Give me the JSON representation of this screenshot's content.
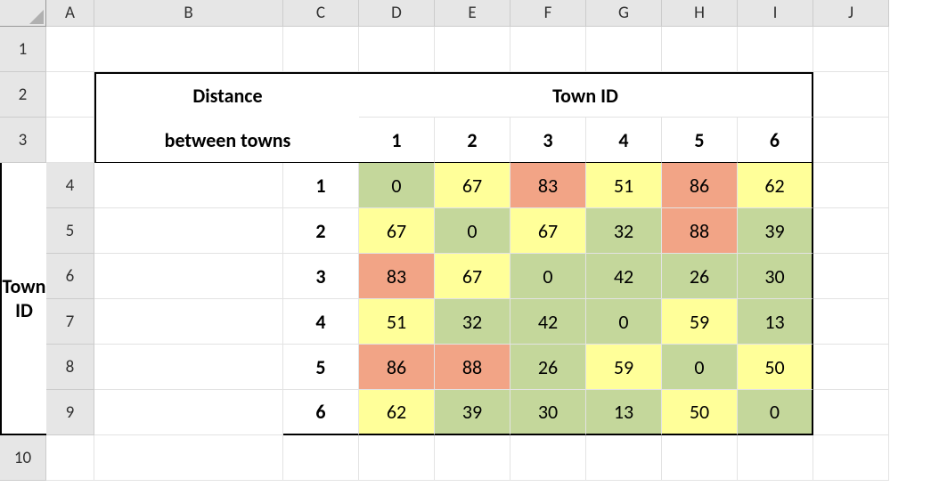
{
  "columns": [
    "A",
    "B",
    "C",
    "D",
    "E",
    "F",
    "G",
    "H",
    "I",
    "J"
  ],
  "rows": [
    "1",
    "2",
    "3",
    "4",
    "5",
    "6",
    "7",
    "8",
    "9",
    "10"
  ],
  "labels": {
    "distance_line1": "Distance",
    "distance_line2": "between towns",
    "town_id_top": "Town ID",
    "town_id_left": "Town ID"
  },
  "col_ids": [
    "1",
    "2",
    "3",
    "4",
    "5",
    "6"
  ],
  "row_ids": [
    "1",
    "2",
    "3",
    "4",
    "5",
    "6"
  ],
  "chart_data": {
    "type": "heatmap",
    "title": "Distance between towns",
    "xlabel": "Town ID",
    "ylabel": "Town ID",
    "categories_x": [
      "1",
      "2",
      "3",
      "4",
      "5",
      "6"
    ],
    "categories_y": [
      "1",
      "2",
      "3",
      "4",
      "5",
      "6"
    ],
    "matrix": [
      [
        0,
        67,
        83,
        51,
        86,
        62
      ],
      [
        67,
        0,
        67,
        32,
        88,
        39
      ],
      [
        83,
        67,
        0,
        42,
        26,
        30
      ],
      [
        51,
        32,
        42,
        0,
        59,
        13
      ],
      [
        86,
        88,
        26,
        59,
        0,
        50
      ],
      [
        62,
        39,
        30,
        13,
        50,
        0
      ]
    ],
    "color_scale": {
      "low": "#c4d79b",
      "mid": "#ffff99",
      "high": "#f2a486",
      "thresholds": {
        "low_max": 45,
        "mid_max": 70
      }
    }
  }
}
